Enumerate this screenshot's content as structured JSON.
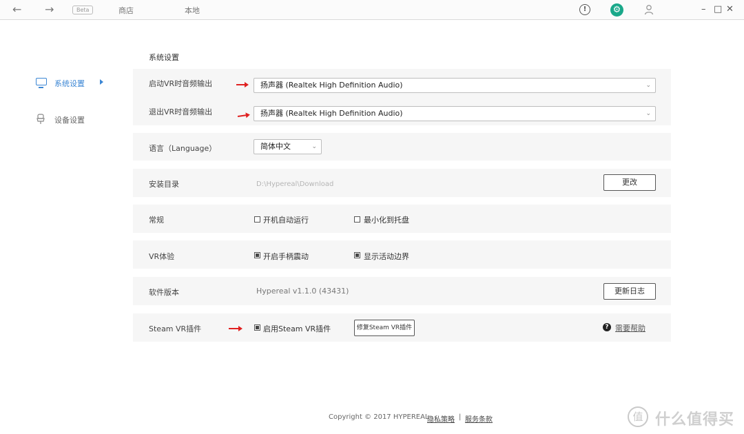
{
  "topbar": {
    "back_icon": "arrow-left-icon",
    "forward_icon": "arrow-right-icon",
    "beta_badge": "Beta",
    "tabs": [
      "商店",
      "本地"
    ],
    "alert_icon": "alert-circle-icon",
    "settings_icon": "gear-icon",
    "user_icon": "user-icon",
    "settings_icon_color": "#1aa88a"
  },
  "sidebar": {
    "items": [
      {
        "label": "系统设置",
        "icon": "monitor-icon",
        "active": true
      },
      {
        "label": "设备设置",
        "icon": "device-icon",
        "active": false
      }
    ],
    "accent_color": "#3b86d4"
  },
  "main": {
    "section_title": "系统设置",
    "audio_start_label": "启动VR时音频输出",
    "audio_start_value": "扬声器 (Realtek High Definition Audio)",
    "audio_exit_label": "退出VR时音频输出",
    "audio_exit_value": "扬声器 (Realtek High Definition Audio)",
    "language_label": "语言（Language）",
    "language_value": "简体中文",
    "install_dir_label": "安装目录",
    "install_dir_value": "D:\\Hypereal\\Download",
    "change_button": "更改",
    "general_label": "常规",
    "auto_start_label": "开机自动运行",
    "auto_start_checked": false,
    "minimize_tray_label": "最小化到托盘",
    "minimize_tray_checked": false,
    "vr_exp_label": "VR体验",
    "controller_vibration_label": "开启手柄震动",
    "controller_vibration_checked": true,
    "show_boundary_label": "显示活动边界",
    "show_boundary_checked": true,
    "version_label": "软件版本",
    "version_value": "Hypereal v1.1.0 (43431)",
    "changelog_button": "更新日志",
    "steam_label": "Steam VR插件",
    "enable_steam_label": "启用Steam VR插件",
    "enable_steam_checked": true,
    "repair_steam_button": "修复Steam VR插件",
    "help_icon": "question-circle-icon",
    "help_link": "需要帮助",
    "annotation_color": "#e02020"
  },
  "footer": {
    "copyright": "Copyright © 2017 HYPEREAL",
    "privacy": "隐私策略",
    "separator": "|",
    "terms": "服务条款"
  },
  "watermark": {
    "logo_glyph": "值",
    "text": "什么值得买"
  }
}
